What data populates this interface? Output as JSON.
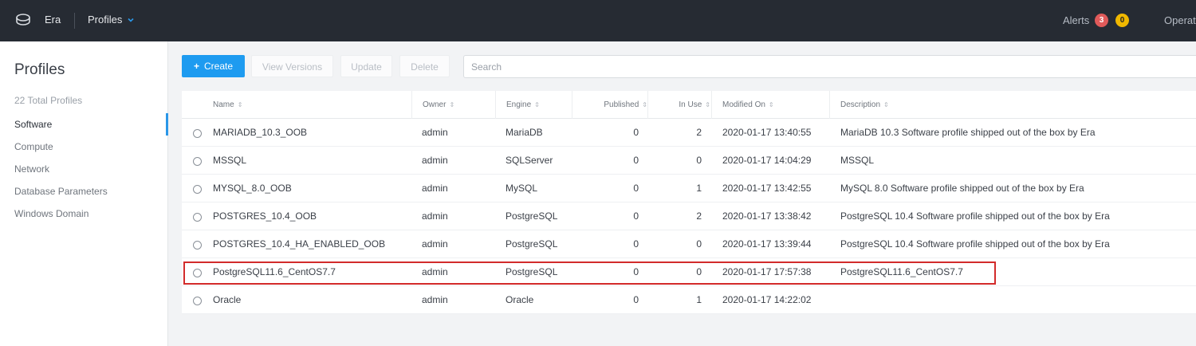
{
  "topbar": {
    "app_name": "Era",
    "nav_menu_label": "Profiles",
    "alerts_label": "Alerts",
    "alerts_critical_count": "3",
    "alerts_warning_count": "0",
    "operations_label": "Operations",
    "colors": {
      "background": "#262b33",
      "critical": "#e05a5a",
      "warning": "#f0b800"
    },
    "icons": {
      "logo": "era-logo-icon",
      "menu_chevron": "chevron-down-icon"
    }
  },
  "sidebar": {
    "title": "Profiles",
    "total": "22 Total Profiles",
    "items": [
      {
        "label": "Software",
        "active": true
      },
      {
        "label": "Compute",
        "active": false
      },
      {
        "label": "Network",
        "active": false
      },
      {
        "label": "Database Parameters",
        "active": false
      },
      {
        "label": "Windows Domain",
        "active": false
      }
    ]
  },
  "toolbar": {
    "create_label": "Create",
    "create_icon": "+",
    "view_versions_label": "View Versions",
    "update_label": "Update",
    "delete_label": "Delete",
    "search_placeholder": "Search",
    "accent_color": "#1e9bf0"
  },
  "table": {
    "columns": [
      "Name",
      "Owner",
      "Engine",
      "Published",
      "In Use",
      "Modified On",
      "Description"
    ],
    "sort_icon": "sort-arrows-icon",
    "rows": [
      {
        "name": "MARIADB_10.3_OOB",
        "owner": "admin",
        "engine": "MariaDB",
        "published": "0",
        "in_use": "2",
        "modified": "2020-01-17 13:40:55",
        "description": "MariaDB 10.3 Software profile shipped out of the box by Era"
      },
      {
        "name": "MSSQL",
        "owner": "admin",
        "engine": "SQLServer",
        "published": "0",
        "in_use": "0",
        "modified": "2020-01-17 14:04:29",
        "description": "MSSQL"
      },
      {
        "name": "MYSQL_8.0_OOB",
        "owner": "admin",
        "engine": "MySQL",
        "published": "0",
        "in_use": "1",
        "modified": "2020-01-17 13:42:55",
        "description": "MySQL 8.0 Software profile shipped out of the box by Era"
      },
      {
        "name": "POSTGRES_10.4_OOB",
        "owner": "admin",
        "engine": "PostgreSQL",
        "published": "0",
        "in_use": "2",
        "modified": "2020-01-17 13:38:42",
        "description": "PostgreSQL 10.4 Software profile shipped out of the box by Era"
      },
      {
        "name": "POSTGRES_10.4_HA_ENABLED_OOB",
        "owner": "admin",
        "engine": "PostgreSQL",
        "published": "0",
        "in_use": "0",
        "modified": "2020-01-17 13:39:44",
        "description": "PostgreSQL 10.4 Software profile shipped out of the box by Era"
      },
      {
        "name": "PostgreSQL11.6_CentOS7.7",
        "owner": "admin",
        "engine": "PostgreSQL",
        "published": "0",
        "in_use": "0",
        "modified": "2020-01-17 17:57:38",
        "description": "PostgreSQL11.6_CentOS7.7"
      },
      {
        "name": "Oracle",
        "owner": "admin",
        "engine": "Oracle",
        "published": "0",
        "in_use": "1",
        "modified": "2020-01-17 14:22:02",
        "description": ""
      }
    ],
    "highlight_color": "#d22b2b"
  }
}
